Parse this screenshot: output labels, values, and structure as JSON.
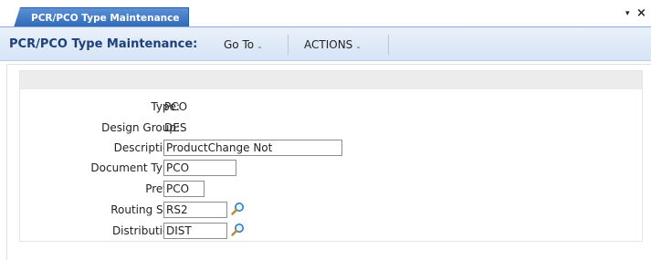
{
  "tab": {
    "title": "PCR/PCO Type Maintenance",
    "menu_glyph": "▾",
    "close_glyph": "×"
  },
  "header": {
    "title": "PCR/PCO Type Maintenance:",
    "menus": [
      {
        "label": "Go To",
        "chevron": "⌄"
      },
      {
        "label": "ACTIONS",
        "chevron": "⌄"
      }
    ]
  },
  "form": {
    "type": {
      "label": "Type:",
      "value": "PCO"
    },
    "design_group": {
      "label": "Design Group:",
      "value": "DES"
    },
    "description": {
      "label": "Description:",
      "value": "ProductChange Not"
    },
    "document_type": {
      "label": "Document Type:",
      "value": "PCO"
    },
    "prefix": {
      "label": "Prefix:",
      "value": "PCO"
    },
    "routing_slip": {
      "label": "Routing Slip:",
      "value": "RS2",
      "icon": "magnifier-icon"
    },
    "distribution": {
      "label": "Distribution:",
      "value": "DIST",
      "icon": "magnifier-icon"
    }
  },
  "colors": {
    "tab_bg": "#2f68b6",
    "header_title": "#1d3f7a",
    "header_bg": "#dfeaf7"
  }
}
